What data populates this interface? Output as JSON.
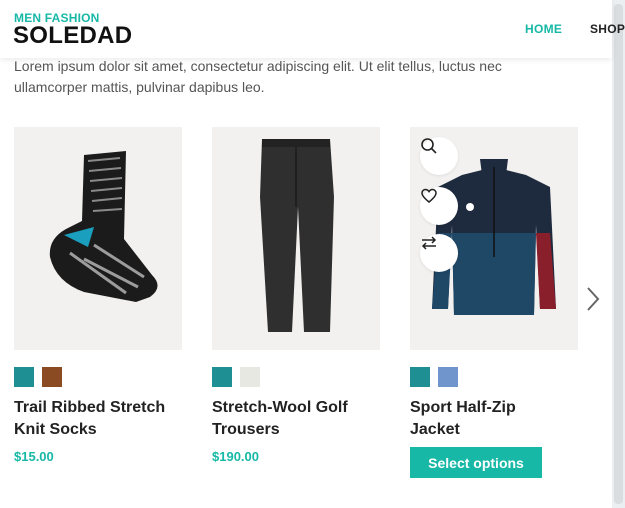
{
  "header": {
    "site_tagline": "MEN FASHION",
    "site_name": "SOLEDAD",
    "nav": [
      {
        "label": "HOME",
        "active": true
      },
      {
        "label": "SHOP",
        "active": false
      }
    ],
    "accent_color": "#17b8a6"
  },
  "intro": {
    "text": "Lorem ipsum dolor sit amet, consectetur adipiscing elit. Ut elit tellus, luctus nec ullamcorper mattis, pulvinar dapibus leo."
  },
  "products": [
    {
      "title_line1": "Trail Ribbed Stretch",
      "title_line2": "Knit Socks",
      "price": "$15.00",
      "swatch_colors": [
        "#1e8f93",
        "#8a4a22"
      ],
      "image_icon": "sock-image"
    },
    {
      "title_line1": "Stretch-Wool Golf",
      "title_line2": "Trousers",
      "price": "$190.00",
      "swatch_colors": [
        "#1e8f93",
        "#e8e8e3"
      ],
      "image_icon": "trousers-image"
    },
    {
      "title_line1": "Sport Half-Zip",
      "title_line2": "Jacket",
      "button_label": "Select options",
      "swatch_colors": [
        "#1e8f93",
        "#6f95cc"
      ],
      "image_icon": "jacket-image",
      "actions": [
        "search-icon",
        "heart-icon",
        "compare-icon"
      ]
    }
  ],
  "carousel": {
    "next_icon": "chevron-right-icon"
  }
}
